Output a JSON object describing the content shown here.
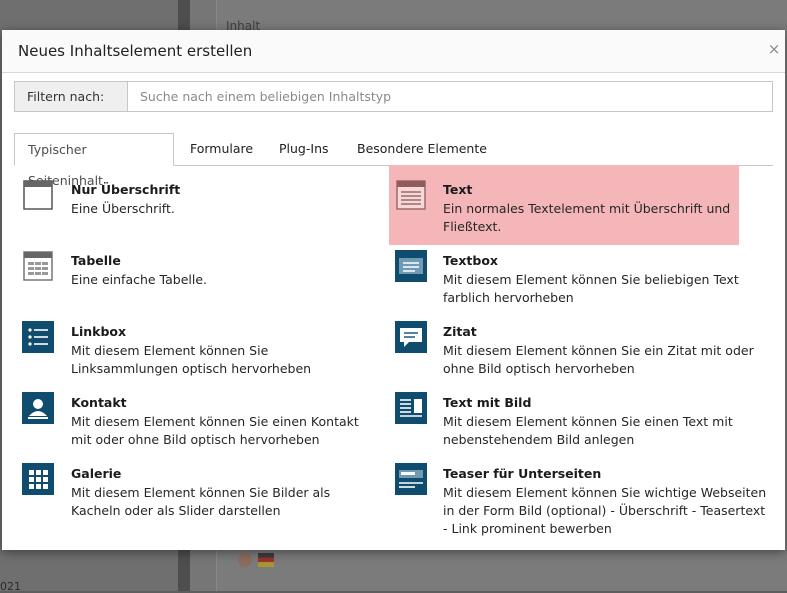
{
  "background": {
    "heading": "Inhalt",
    "year": "021"
  },
  "modal": {
    "title": "Neues Inhaltselement erstellen",
    "close": "×"
  },
  "filter": {
    "label": "Filtern nach:",
    "placeholder": "Suche nach einem beliebigen Inhaltstyp",
    "value": ""
  },
  "tabs": [
    "Typischer Seiteninhalt",
    "Formulare",
    "Plug-Ins",
    "Besondere Elemente"
  ],
  "active_tab": 0,
  "items": [
    {
      "title": "Nur Überschrift",
      "desc": "Eine Überschrift.",
      "icon": "header-only-icon"
    },
    {
      "title": "Text",
      "desc": "Ein normales Textelement mit Überschrift und Fließtext.",
      "icon": "text-icon",
      "highlighted": true
    },
    {
      "title": "Tabelle",
      "desc": "Eine einfache Tabelle.",
      "icon": "table-icon"
    },
    {
      "title": "Textbox",
      "desc": "Mit diesem Element können Sie beliebigen Text farblich hervorheben",
      "icon": "textbox-icon"
    },
    {
      "title": "Linkbox",
      "desc": "Mit diesem Element können Sie Linksammlungen optisch hervorheben",
      "icon": "linkbox-icon"
    },
    {
      "title": "Zitat",
      "desc": "Mit diesem Element können Sie ein Zitat mit oder ohne Bild optisch hervorheben",
      "icon": "quote-icon"
    },
    {
      "title": "Kontakt",
      "desc": "Mit diesem Element können Sie einen Kontakt mit oder ohne Bild optisch hervorheben",
      "icon": "contact-icon"
    },
    {
      "title": "Text mit Bild",
      "desc": "Mit diesem Element können Sie einen Text mit nebenstehendem Bild anlegen",
      "icon": "text-image-icon"
    },
    {
      "title": "Galerie",
      "desc": "Mit diesem Element können Sie Bilder als Kacheln oder als Slider darstellen",
      "icon": "gallery-icon"
    },
    {
      "title": "Teaser für Unterseiten",
      "desc": "Mit diesem Element können Sie wichtige Webseiten in der Form Bild (optional) - Überschrift - Teasertext - Link prominent bewerben",
      "icon": "teaser-icon"
    }
  ],
  "colors": {
    "highlight": "#f4b6b8",
    "icon_dark": "#0f4c6d",
    "icon_light": "#666666"
  }
}
